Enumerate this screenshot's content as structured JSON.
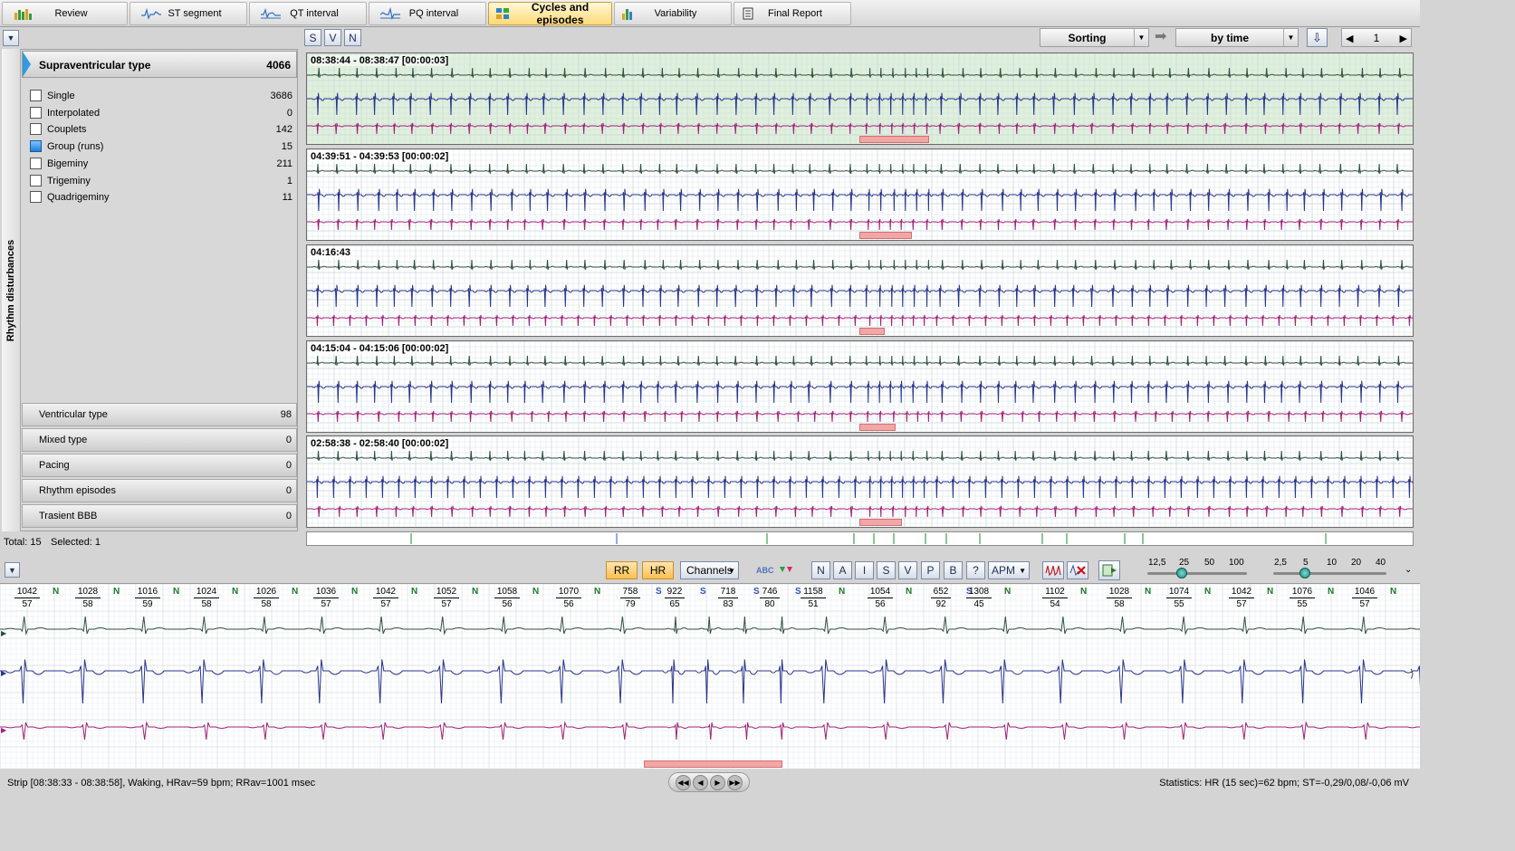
{
  "tabs": [
    {
      "label": "Review",
      "icon": "bars-chart-icon"
    },
    {
      "label": "ST segment",
      "icon": "st-wave-icon"
    },
    {
      "label": "QT interval",
      "icon": "qt-wave-icon"
    },
    {
      "label": "PQ interval",
      "icon": "pq-wave-icon"
    },
    {
      "label": "Cycles and episodes",
      "icon": "grid-icon",
      "active": true
    },
    {
      "label": "Variability",
      "icon": "histogram-icon"
    },
    {
      "label": "Final Report",
      "icon": "document-icon"
    }
  ],
  "toolbar": {
    "filter_buttons": [
      "S",
      "V",
      "N"
    ],
    "sorting_label": "Sorting",
    "sort_by": "by time",
    "page": "1"
  },
  "sidebar": {
    "vertical_tab": "Rhythm disturbances",
    "group_title": "Supraventricular type",
    "group_count": "4066",
    "items": [
      {
        "label": "Single",
        "count": "3686",
        "checked": false
      },
      {
        "label": "Interpolated",
        "count": "0",
        "checked": false
      },
      {
        "label": "Couplets",
        "count": "142",
        "checked": false
      },
      {
        "label": "Group (runs)",
        "count": "15",
        "checked": true
      },
      {
        "label": "Bigeminy",
        "count": "211",
        "checked": false
      },
      {
        "label": "Trigeminy",
        "count": "1",
        "checked": false
      },
      {
        "label": "Quadrigeminy",
        "count": "11",
        "checked": false
      }
    ],
    "categories": [
      {
        "label": "Ventricular type",
        "count": "98"
      },
      {
        "label": "Mixed type",
        "count": "0"
      },
      {
        "label": "Pacing",
        "count": "0"
      },
      {
        "label": "Rhythm episodes",
        "count": "0"
      },
      {
        "label": "Trasient BBB",
        "count": "0"
      }
    ],
    "total_label": "Total: 15",
    "selected_label": "Selected: 1"
  },
  "strips": [
    {
      "title": "08:38:44 - 08:38:47 [00:00:03]",
      "selected": true
    },
    {
      "title": "04:39:51 - 04:39:53 [00:00:02]"
    },
    {
      "title": "04:16:43"
    },
    {
      "title": "04:15:04 - 04:15:06 [00:00:02]"
    },
    {
      "title": "02:58:38 - 02:58:40 [00:00:02]"
    }
  ],
  "bottom": {
    "rr_button": "RR",
    "hr_button": "HR",
    "channels": "Channels",
    "abc": "ABC",
    "beat_buttons": [
      "N",
      "A",
      "I",
      "S",
      "V",
      "P",
      "B",
      "?"
    ],
    "apm": "APM",
    "speed_ticks": [
      "12,5",
      "25",
      "50",
      "100"
    ],
    "gain_ticks": [
      "2,5",
      "5",
      "10",
      "20",
      "40"
    ],
    "speed_value": 25,
    "gain_value": 5,
    "rr": [
      {
        "rr": "1042",
        "hr": "57",
        "type": "N"
      },
      {
        "rr": "1028",
        "hr": "58",
        "type": "N"
      },
      {
        "rr": "1016",
        "hr": "59",
        "type": "N"
      },
      {
        "rr": "1024",
        "hr": "58",
        "type": "N"
      },
      {
        "rr": "1026",
        "hr": "58",
        "type": "N"
      },
      {
        "rr": "1036",
        "hr": "57",
        "type": "N"
      },
      {
        "rr": "1042",
        "hr": "57",
        "type": "N"
      },
      {
        "rr": "1052",
        "hr": "57",
        "type": "N"
      },
      {
        "rr": "1058",
        "hr": "56",
        "type": "N"
      },
      {
        "rr": "1070",
        "hr": "56",
        "type": "N"
      },
      {
        "rr": "758",
        "hr": "79",
        "type": "S"
      },
      {
        "rr": "922",
        "hr": "65",
        "type": "S"
      },
      {
        "rr": "718",
        "hr": "83",
        "type": "S"
      },
      {
        "rr": "746",
        "hr": "80",
        "type": "S"
      },
      {
        "rr": "1158",
        "hr": "51",
        "type": "N"
      },
      {
        "rr": "1054",
        "hr": "56",
        "type": "N"
      },
      {
        "rr": "652",
        "hr": "92",
        "type": "S"
      },
      {
        "rr": "1308",
        "hr": "45",
        "type": "N"
      },
      {
        "rr": "1102",
        "hr": "54",
        "type": "N"
      },
      {
        "rr": "1028",
        "hr": "58",
        "type": "N"
      },
      {
        "rr": "1074",
        "hr": "55",
        "type": "N"
      },
      {
        "rr": "1042",
        "hr": "57",
        "type": "N"
      },
      {
        "rr": "1076",
        "hr": "55",
        "type": "N"
      },
      {
        "rr": "1046",
        "hr": "57",
        "type": "N"
      }
    ]
  },
  "status": {
    "left": "Strip [08:38:33 - 08:38:58], Waking,  HRav=59 bpm; RRav=1001 msec",
    "right": "Statistics: HR (15 sec)=62 bpm; ST=-0,29/0,08/-0,06 mV"
  },
  "colors": {
    "ch1": "#2f4f3f",
    "ch2": "#28348c",
    "ch3": "#a0207a",
    "selected_bg": "#dff0dc",
    "grid": "#c8d4dc",
    "marker": "#f2a6a6"
  }
}
